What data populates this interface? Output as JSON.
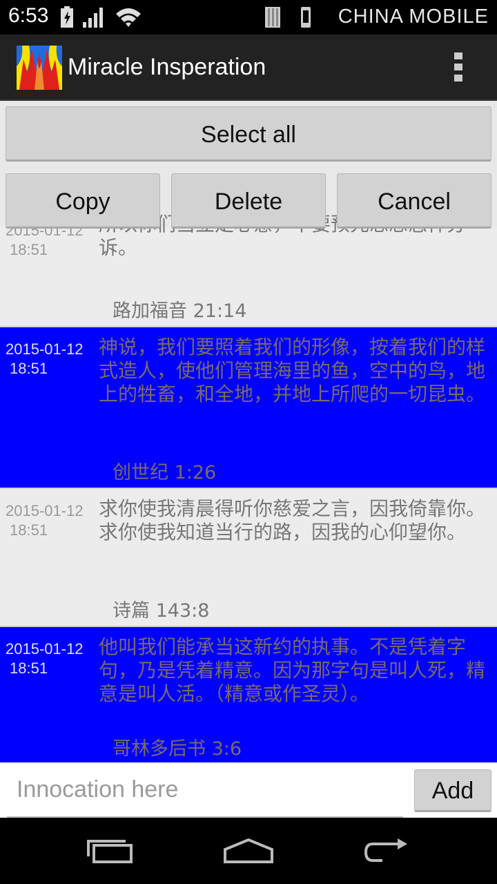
{
  "status_bar": {
    "time": "6:53",
    "carrier": "CHINA  MOBILE"
  },
  "action_bar": {
    "title": "Miracle Insperation"
  },
  "toolbar": {
    "select_all_label": "Select all",
    "copy_label": "Copy",
    "delete_label": "Delete",
    "cancel_label": "Cancel"
  },
  "entries": [
    {
      "date": "2015-01-12",
      "time": "18:51",
      "text": "所以你们当立定心意，不要预先思想怎样分诉。",
      "reference": "路加福音 21:14",
      "selected": false
    },
    {
      "date": "2015-01-12",
      "time": "18:51",
      "text": "神说，我们要照着我们的形像，按着我们的样式造人，使他们管理海里的鱼，空中的鸟，地上的牲畜，和全地，并地上所爬的一切昆虫。",
      "reference": "创世纪 1:26",
      "selected": true
    },
    {
      "date": "2015-01-12",
      "time": "18:51",
      "text": "求你使我清晨得听你慈爱之言，因我倚靠你。求你使我知道当行的路，因我的心仰望你。",
      "reference": "诗篇 143:8",
      "selected": false
    },
    {
      "date": "2015-01-12",
      "time": "18:51",
      "text": "他叫我们能承当这新约的执事。不是凭着字句，乃是凭着精意。因为那字句是叫人死，精意是叫人活。（精意或作圣灵）。",
      "reference": "哥林多后书 3:6",
      "selected": true
    }
  ],
  "input": {
    "placeholder": "Innocation here",
    "value": "",
    "add_label": "Add"
  },
  "colors": {
    "selected_row": "#0000ff",
    "normal_row": "#ececec",
    "action_bar": "#222222"
  }
}
